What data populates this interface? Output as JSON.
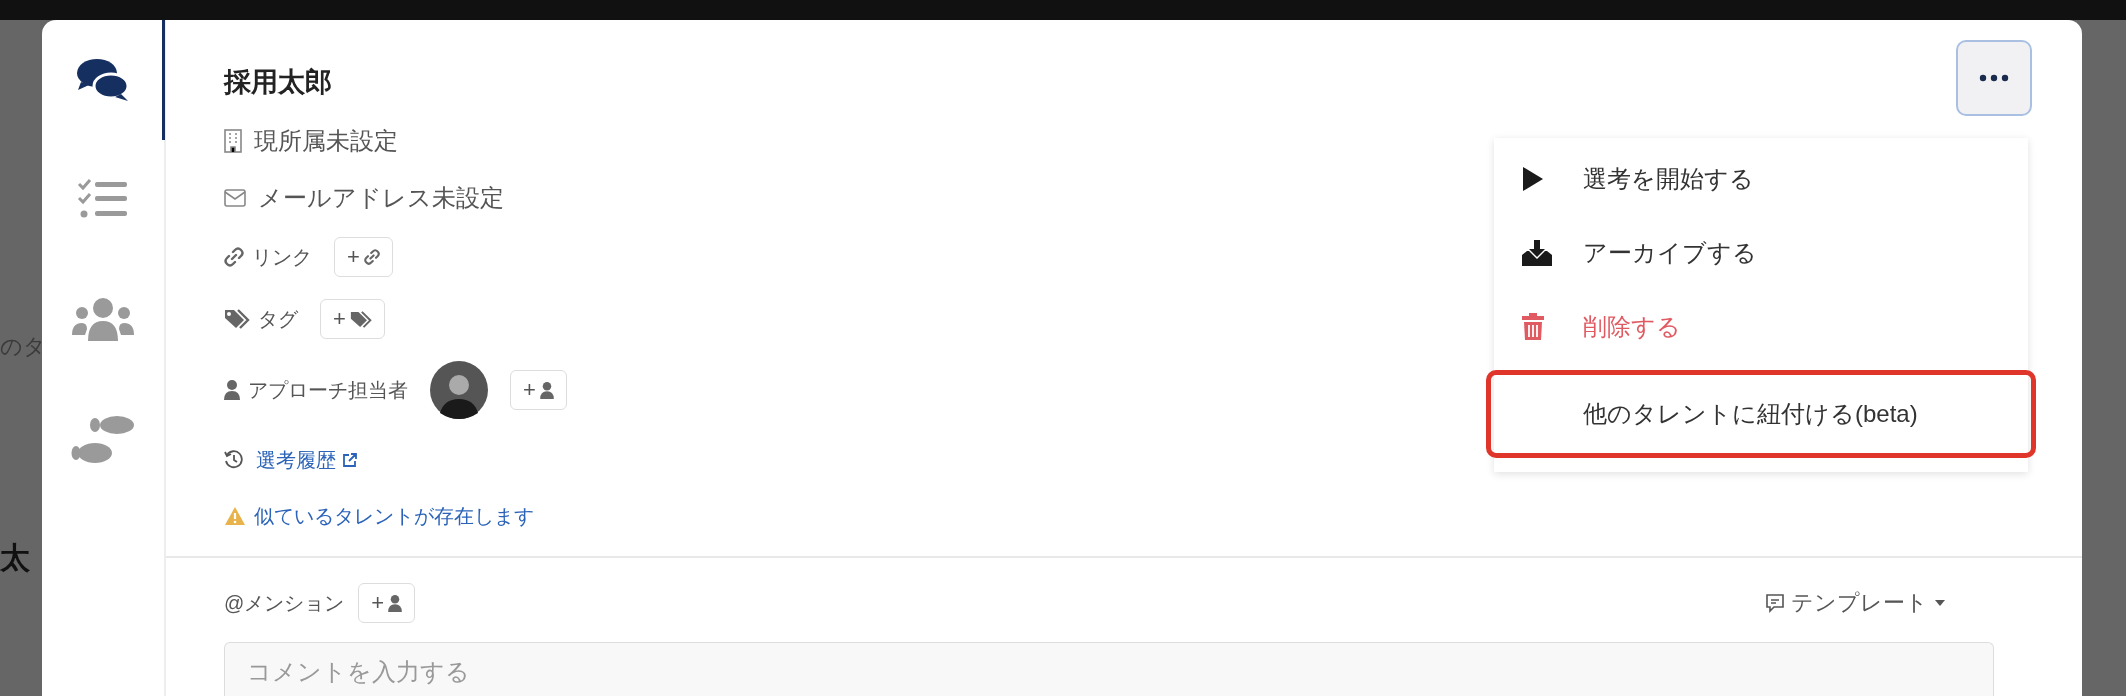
{
  "backdrop": {
    "fragments": [
      {
        "kind": "plain",
        "text": "のタ"
      },
      {
        "kind": "bold",
        "text": "太"
      }
    ]
  },
  "nav": [
    {
      "kind": "chat",
      "selected": true
    },
    {
      "kind": "tasks",
      "selected": false
    },
    {
      "kind": "people",
      "selected": false
    },
    {
      "kind": "steps",
      "selected": false
    }
  ],
  "talent": {
    "name": "採用太郎",
    "affiliation": "現所属未設定",
    "email": "メールアドレス未設定"
  },
  "fields": [
    {
      "kind": "link",
      "label": "リンク",
      "add": "+"
    },
    {
      "kind": "tag",
      "label": "タグ",
      "add": "+"
    },
    {
      "kind": "person",
      "label": "アプローチ担当者",
      "add": "+"
    }
  ],
  "history_link": "選考履歴",
  "warning": "似ているタレントが存在します",
  "mention": {
    "label": "@メンション",
    "add": "+"
  },
  "template": "テンプレート",
  "comment": {
    "placeholder": "コメントを入力する"
  },
  "menu": [
    {
      "kind": "play",
      "label": "選考を開始する",
      "danger": false,
      "highlighted": false
    },
    {
      "kind": "archive",
      "label": "アーカイブする",
      "danger": false,
      "highlighted": false
    },
    {
      "kind": "trash",
      "label": "削除する",
      "danger": true,
      "highlighted": false
    },
    {
      "kind": "none",
      "label": "他のタレントに紐付ける(beta)",
      "danger": false,
      "highlighted": true
    }
  ]
}
